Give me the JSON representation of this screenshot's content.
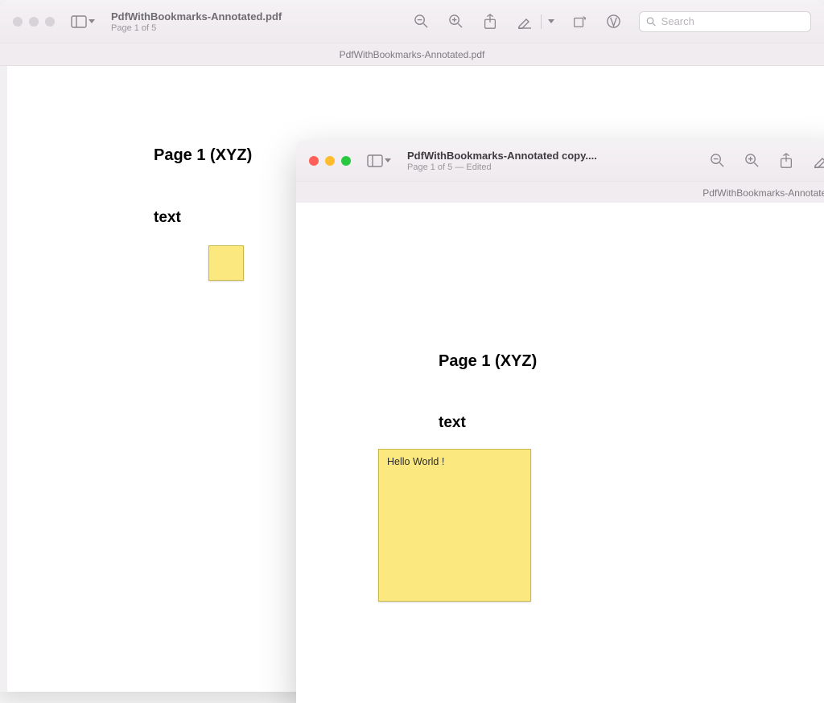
{
  "window1": {
    "title": "PdfWithBookmarks-Annotated.pdf",
    "subtitle": "Page 1 of 5",
    "tab_label": "PdfWithBookmarks-Annotated.pdf",
    "search_placeholder": "Search",
    "page": {
      "heading": "Page 1 (XYZ)",
      "subheading": "text"
    }
  },
  "window2": {
    "title": "PdfWithBookmarks-Annotated copy....",
    "subtitle": "Page 1 of 5 — Edited",
    "tab_label": "PdfWithBookmarks-Annotated",
    "page": {
      "heading": "Page 1 (XYZ)",
      "subheading": "text",
      "note_text": "Hello World !"
    }
  }
}
